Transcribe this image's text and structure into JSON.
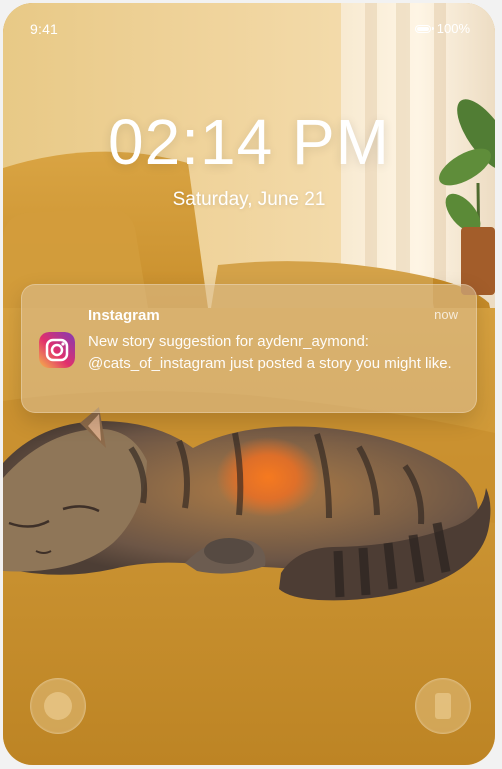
{
  "status_bar": {
    "time": "9:41",
    "battery": "100%"
  },
  "lock_screen": {
    "clock": "02:14 PM",
    "date": "Saturday, June 21"
  },
  "notification": {
    "app_name": "Instagram",
    "time": "now",
    "body": "New story suggestion for aydenr_aymond: @cats_of_instagram just posted a story you might like.",
    "icon": "instagram-icon"
  },
  "bottom_controls": [
    {
      "name": "flashlight",
      "icon": "flashlight-icon"
    },
    {
      "name": "camera",
      "icon": "camera-icon"
    }
  ],
  "colors": {
    "accent": "#f6b64a",
    "text": "#ffffff"
  }
}
